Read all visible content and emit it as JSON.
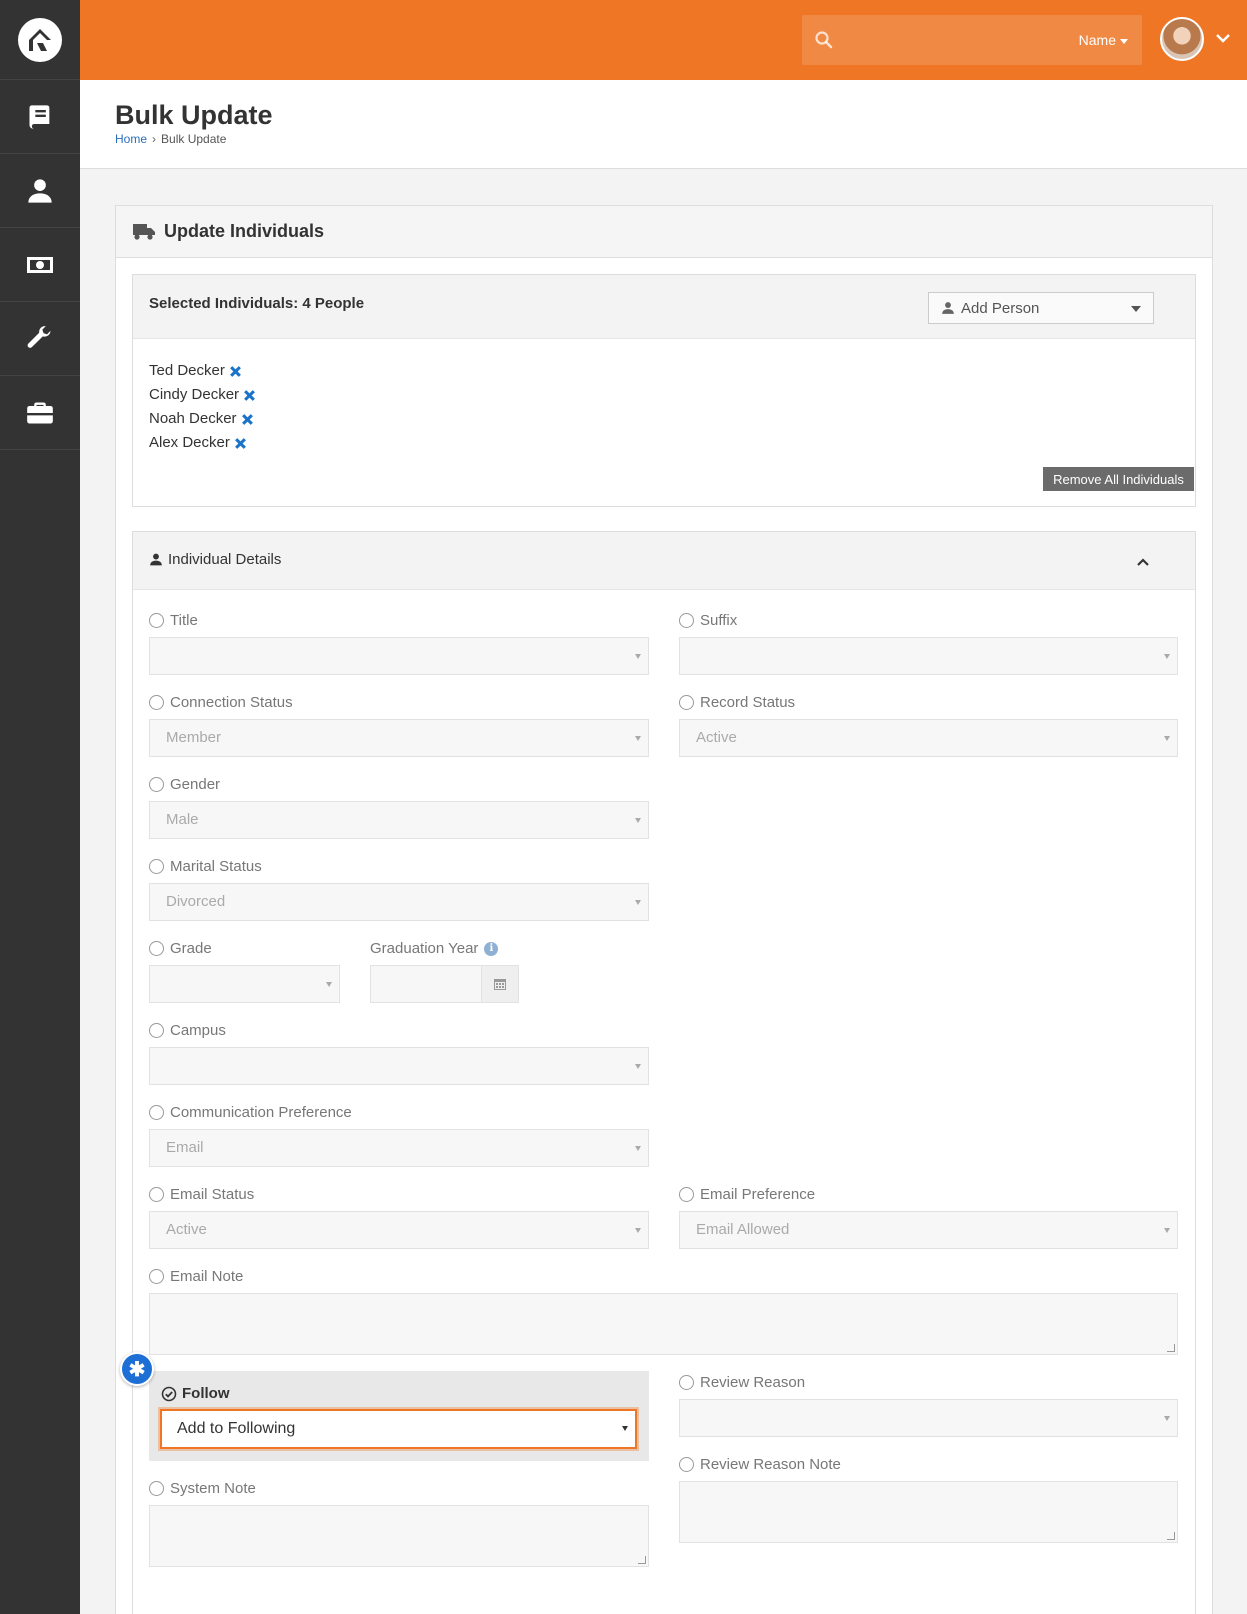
{
  "header": {
    "search_placeholder": "",
    "search_type": "Name"
  },
  "page": {
    "title": "Bulk Update",
    "breadcrumb": [
      "Home",
      "Bulk Update"
    ]
  },
  "panel": {
    "title": "Update Individuals",
    "selected_label": "Selected Individuals: 4 People",
    "add_person": "Add Person",
    "people": [
      "Ted Decker",
      "Cindy Decker",
      "Noah Decker",
      "Alex Decker"
    ],
    "remove_all": "Remove All Individuals"
  },
  "details": {
    "title": "Individual Details",
    "fields": {
      "title": {
        "label": "Title",
        "value": ""
      },
      "suffix": {
        "label": "Suffix",
        "value": ""
      },
      "connection_status": {
        "label": "Connection Status",
        "value": "Member"
      },
      "record_status": {
        "label": "Record Status",
        "value": "Active"
      },
      "gender": {
        "label": "Gender",
        "value": "Male"
      },
      "marital_status": {
        "label": "Marital Status",
        "value": "Divorced"
      },
      "grade": {
        "label": "Grade",
        "value": ""
      },
      "graduation_year": {
        "label": "Graduation Year",
        "value": ""
      },
      "campus": {
        "label": "Campus",
        "value": ""
      },
      "communication_preference": {
        "label": "Communication Preference",
        "value": "Email"
      },
      "email_status": {
        "label": "Email Status",
        "value": "Active"
      },
      "email_preference": {
        "label": "Email Preference",
        "value": "Email Allowed"
      },
      "email_note": {
        "label": "Email Note"
      },
      "follow": {
        "label": "Follow",
        "value": "Add to Following"
      },
      "review_reason": {
        "label": "Review Reason",
        "value": ""
      },
      "review_reason_note": {
        "label": "Review Reason Note"
      },
      "system_note": {
        "label": "System Note"
      }
    }
  },
  "colors": {
    "brand_orange": "#ee7625",
    "sidebar": "#333333",
    "link_blue": "#2a6ebb",
    "badge_blue": "#1d6fd6",
    "remove_x_blue": "#1a73c9"
  }
}
